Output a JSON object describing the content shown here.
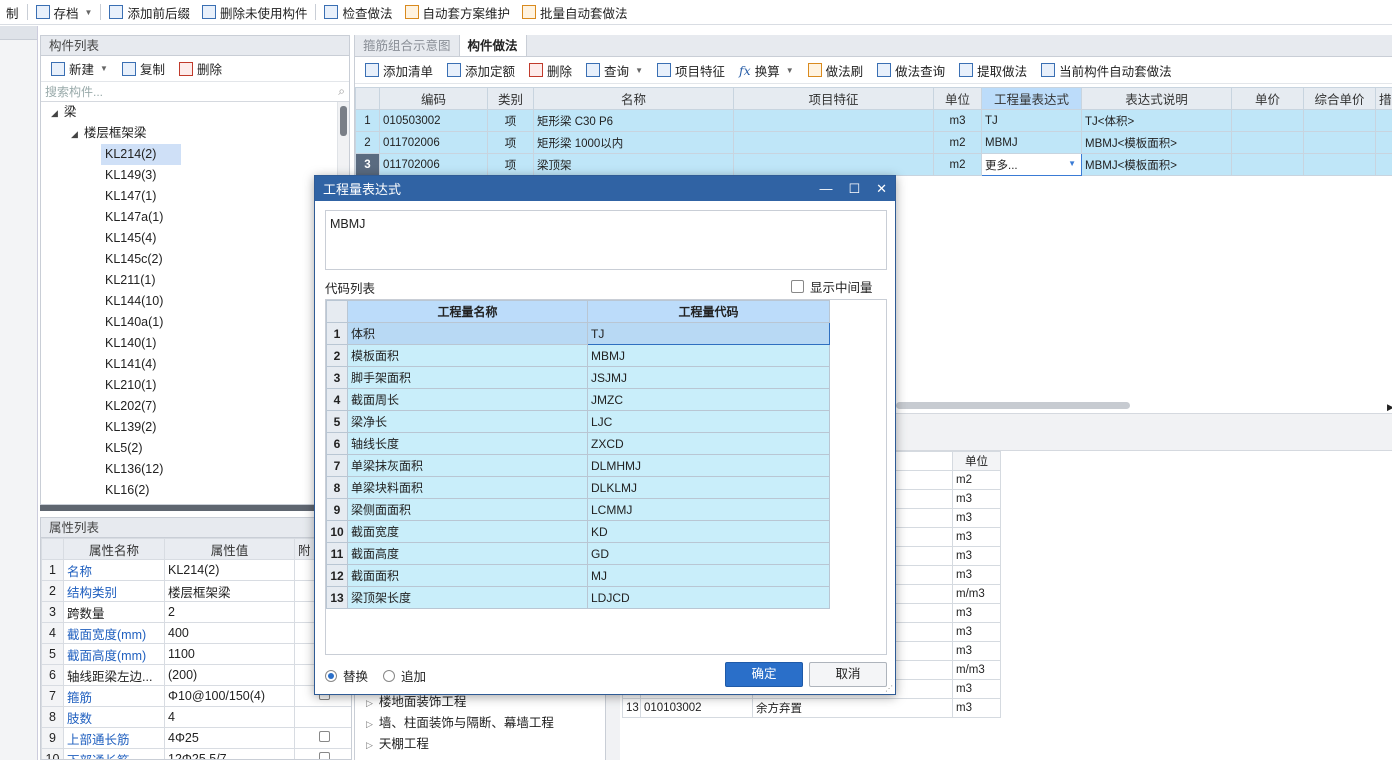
{
  "toolbar": {
    "items": [
      {
        "label": "制"
      },
      {
        "label": "存档"
      },
      {
        "label": "添加前后缀"
      },
      {
        "label": "删除未使用构件"
      },
      {
        "label": "检查做法"
      },
      {
        "label": "自动套方案维护"
      },
      {
        "label": "批量自动套做法"
      }
    ]
  },
  "component_panel": {
    "title": "构件列表",
    "new": "新建",
    "copy": "复制",
    "delete": "删除",
    "search_placeholder": "搜索构件...",
    "tree": [
      {
        "label": "梁",
        "level": 0
      },
      {
        "label": "楼层框架梁",
        "level": 1
      },
      {
        "label": "KL214(2)",
        "level": 2,
        "selected": true
      },
      {
        "label": "KL149(3)",
        "level": 2
      },
      {
        "label": "KL147(1)",
        "level": 2
      },
      {
        "label": "KL147a(1)",
        "level": 2
      },
      {
        "label": "KL145(4)",
        "level": 2
      },
      {
        "label": "KL145c(2)",
        "level": 2
      },
      {
        "label": "KL211(1)",
        "level": 2
      },
      {
        "label": "KL144(10)",
        "level": 2
      },
      {
        "label": "KL140a(1)",
        "level": 2
      },
      {
        "label": "KL140(1)",
        "level": 2
      },
      {
        "label": "KL141(4)",
        "level": 2
      },
      {
        "label": "KL210(1)",
        "level": 2
      },
      {
        "label": "KL202(7)",
        "level": 2
      },
      {
        "label": "KL139(2)",
        "level": 2
      },
      {
        "label": "KL5(2)",
        "level": 2
      },
      {
        "label": "KL136(12)",
        "level": 2
      },
      {
        "label": "KL16(2)",
        "level": 2
      }
    ]
  },
  "attr_panel": {
    "title": "属性列表",
    "col_name": "属性名称",
    "col_value": "属性值",
    "col_extra": "附",
    "rows": [
      {
        "n": "1",
        "name": "名称",
        "value": "KL214(2)",
        "blue": true,
        "cb": false
      },
      {
        "n": "2",
        "name": "结构类别",
        "value": "楼层框架梁",
        "blue": true,
        "cb": true
      },
      {
        "n": "3",
        "name": "跨数量",
        "value": "2",
        "blue": false,
        "cb": true
      },
      {
        "n": "4",
        "name": "截面宽度(mm)",
        "value": "400",
        "blue": true,
        "cb": true
      },
      {
        "n": "5",
        "name": "截面高度(mm)",
        "value": "1100",
        "blue": true,
        "cb": true
      },
      {
        "n": "6",
        "name": "轴线距梁左边...",
        "value": "(200)",
        "blue": false,
        "cb": true
      },
      {
        "n": "7",
        "name": "箍筋",
        "value": "Φ10@100/150(4)",
        "blue": true,
        "cb": true
      },
      {
        "n": "8",
        "name": "肢数",
        "value": "4",
        "blue": true,
        "cb": false
      },
      {
        "n": "9",
        "name": "上部通长筋",
        "value": "4Φ25",
        "blue": true,
        "cb": true
      },
      {
        "n": "10",
        "name": "下部通长筋",
        "value": "12Φ25 5/7",
        "blue": true,
        "cb": true
      }
    ]
  },
  "right": {
    "tabs": [
      "箍筋组合示意图",
      "构件做法"
    ],
    "toolbar": [
      "添加清单",
      "添加定额",
      "删除",
      "查询",
      "项目特征",
      "换算",
      "做法刷",
      "做法查询",
      "提取做法",
      "当前构件自动套做法"
    ],
    "grid_headers": [
      "编码",
      "类别",
      "名称",
      "项目特征",
      "单位",
      "工程量表达式",
      "表达式说明",
      "单价",
      "综合单价",
      "措"
    ],
    "grid_rows": [
      {
        "n": "1",
        "code": "010503002",
        "type": "项",
        "name": "矩形梁 C30 P6",
        "feat": "",
        "unit": "m3",
        "expr": "TJ",
        "desc": "TJ<体积>"
      },
      {
        "n": "2",
        "code": "011702006",
        "type": "项",
        "name": "矩形梁 1000以内",
        "feat": "",
        "unit": "m2",
        "expr": "MBMJ",
        "desc": "MBMJ<模板面积>"
      },
      {
        "n": "3",
        "code": "011702006",
        "type": "项",
        "name": "梁顶架",
        "feat": "",
        "unit": "m2",
        "expr": "更多...",
        "desc": "MBMJ<模板面积>"
      }
    ],
    "lower_unit_header": "单位",
    "lower_units": [
      "m2",
      "m3",
      "m3",
      "m3",
      "m3",
      "m3",
      "m/m3",
      "m3",
      "m3",
      "m3",
      "m/m3",
      "m3",
      "m3"
    ],
    "lower_last_row": {
      "n": "13",
      "code": "010103002",
      "name": "余方弃置"
    },
    "lower_tree": [
      "楼地面装饰工程",
      "墙、柱面装饰与隔断、幕墙工程",
      "天棚工程"
    ]
  },
  "dialog": {
    "title": "工程量表达式",
    "expression": "MBMJ",
    "code_list_label": "代码列表",
    "show_mid_label": "显示中间量",
    "col_name": "工程量名称",
    "col_code": "工程量代码",
    "rows": [
      {
        "n": "1",
        "name": "体积",
        "code": "TJ"
      },
      {
        "n": "2",
        "name": "模板面积",
        "code": "MBMJ"
      },
      {
        "n": "3",
        "name": "脚手架面积",
        "code": "JSJMJ"
      },
      {
        "n": "4",
        "name": "截面周长",
        "code": "JMZC"
      },
      {
        "n": "5",
        "name": "梁净长",
        "code": "LJC"
      },
      {
        "n": "6",
        "name": "轴线长度",
        "code": "ZXCD"
      },
      {
        "n": "7",
        "name": "单梁抹灰面积",
        "code": "DLMHMJ"
      },
      {
        "n": "8",
        "name": "单梁块料面积",
        "code": "DLKLMJ"
      },
      {
        "n": "9",
        "name": "梁侧面面积",
        "code": "LCMMJ"
      },
      {
        "n": "10",
        "name": "截面宽度",
        "code": "KD"
      },
      {
        "n": "11",
        "name": "截面高度",
        "code": "GD"
      },
      {
        "n": "12",
        "name": "截面面积",
        "code": "MJ"
      },
      {
        "n": "13",
        "name": "梁顶架长度",
        "code": "LDJCD"
      }
    ],
    "replace_label": "替换",
    "append_label": "追加",
    "ok_label": "确定",
    "cancel_label": "取消"
  }
}
